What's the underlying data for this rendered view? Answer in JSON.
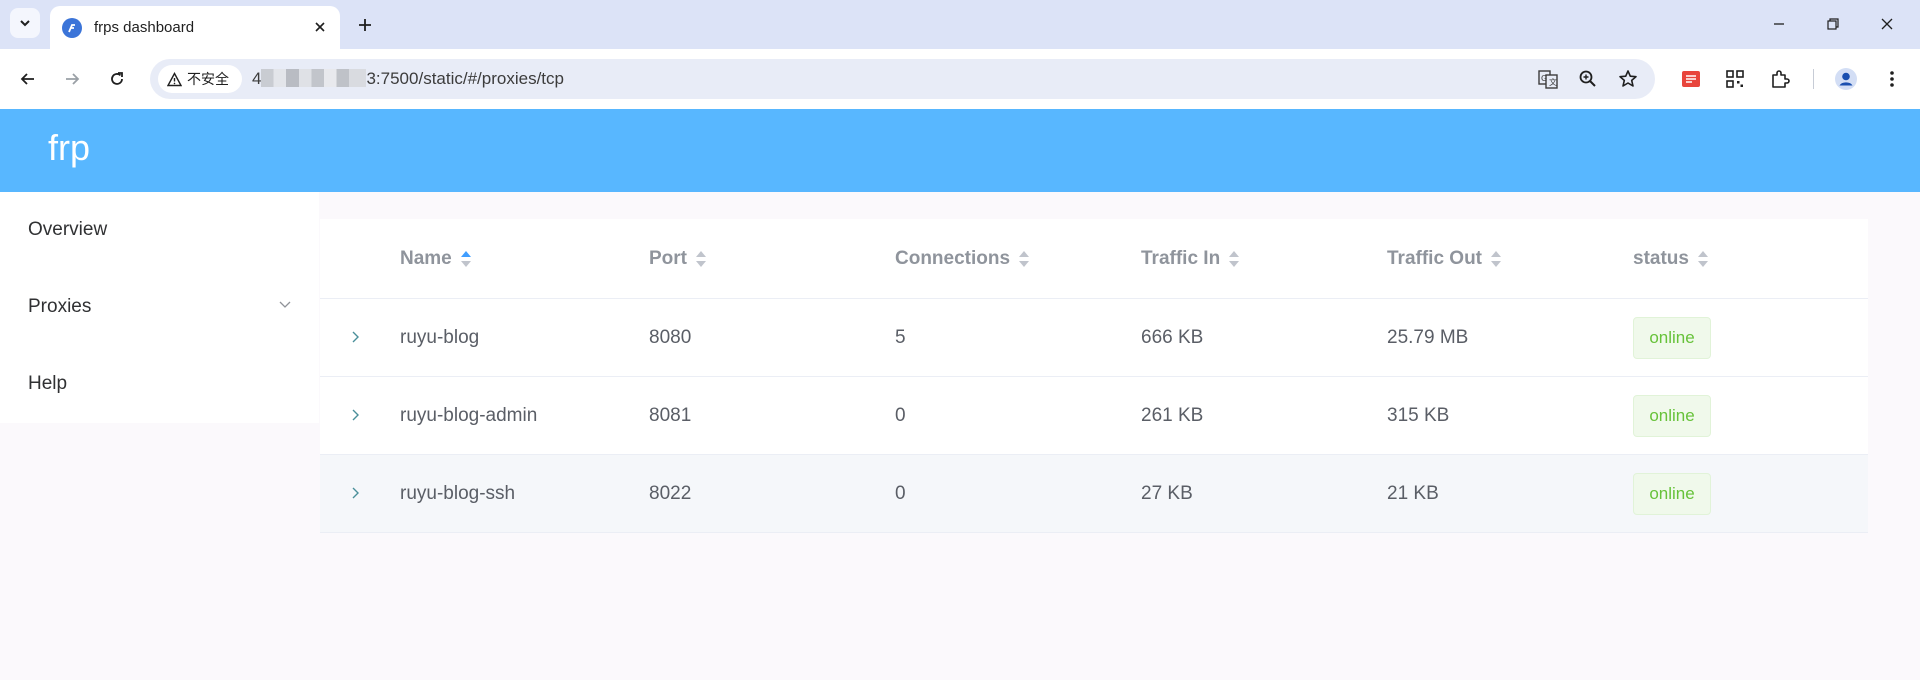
{
  "browser": {
    "tab_title": "frps dashboard",
    "security_label": "不安全",
    "url_prefix": "4",
    "url_suffix": "3:7500/static/#/proxies/tcp"
  },
  "app": {
    "brand": "frp"
  },
  "sidebar": {
    "items": [
      {
        "label": "Overview"
      },
      {
        "label": "Proxies"
      },
      {
        "label": "Help"
      }
    ]
  },
  "table": {
    "columns": [
      {
        "label": "Name",
        "sorted": "ascending"
      },
      {
        "label": "Port"
      },
      {
        "label": "Connections"
      },
      {
        "label": "Traffic In"
      },
      {
        "label": "Traffic Out"
      },
      {
        "label": "status"
      }
    ],
    "rows": [
      {
        "name": "ruyu-blog",
        "port": "8080",
        "connections": "5",
        "traffic_in": "666 KB",
        "traffic_out": "25.79 MB",
        "status": "online"
      },
      {
        "name": "ruyu-blog-admin",
        "port": "8081",
        "connections": "0",
        "traffic_in": "261 KB",
        "traffic_out": "315 KB",
        "status": "online"
      },
      {
        "name": "ruyu-blog-ssh",
        "port": "8022",
        "connections": "0",
        "traffic_in": "27 KB",
        "traffic_out": "21 KB",
        "status": "online"
      }
    ]
  },
  "colors": {
    "header_bg": "#58b7ff",
    "status_online": "#67c23a",
    "sort_active": "#409eff"
  }
}
